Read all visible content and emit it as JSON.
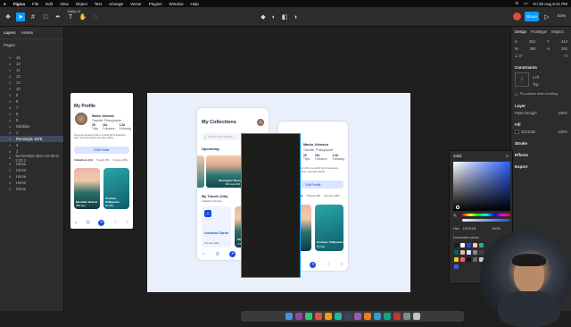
{
  "menubar": {
    "app": "Figma",
    "items": [
      "File",
      "Edit",
      "View",
      "Object",
      "Text",
      "Arrange",
      "Vector",
      "Plugins",
      "Window",
      "Help"
    ],
    "clock": "Fri 29 Aug  8:41 PM"
  },
  "toolbar": {
    "file_tab": "Daily UI",
    "share_label": "Share",
    "zoom": "64%"
  },
  "leftpanel": {
    "tabs": [
      "Layers",
      "Assets"
    ],
    "pages_label": "Pages",
    "layers": [
      {
        "label": "15",
        "selected": false
      },
      {
        "label": "14",
        "selected": false
      },
      {
        "label": "11",
        "selected": false
      },
      {
        "label": "13",
        "selected": false
      },
      {
        "label": "12",
        "selected": false
      },
      {
        "label": "10",
        "selected": false
      },
      {
        "label": "9",
        "selected": false
      },
      {
        "label": "8",
        "selected": false
      },
      {
        "label": "7",
        "selected": false
      },
      {
        "label": "6",
        "selected": false
      },
      {
        "label": "5",
        "selected": false
      },
      {
        "label": "Dribbble",
        "selected": false
      },
      {
        "label": "1",
        "selected": false
      },
      {
        "label": "Rectangle 1878",
        "selected": true
      },
      {
        "label": "3",
        "selected": false
      },
      {
        "label": "2",
        "selected": false
      },
      {
        "label": "Screenshot 2021-10-09 at 2.32.1",
        "selected": false
      },
      {
        "label": "Home",
        "selected": false
      },
      {
        "label": "Home",
        "selected": false
      },
      {
        "label": "Home",
        "selected": false
      },
      {
        "label": "Home",
        "selected": false
      },
      {
        "label": "Home",
        "selected": false
      }
    ]
  },
  "rightpanel": {
    "tabs": [
      "Design",
      "Prototype",
      "Inspect"
    ],
    "x": "350",
    "y": "244",
    "w": "393",
    "h": "393",
    "constraints_label": "Constraints",
    "constraint_h": "Left",
    "constraint_v": "Top",
    "fix_label": "Fix position when scrolling",
    "layer_label": "Layer",
    "pass_through": "Pass through",
    "layer_opacity": "100%",
    "fill_label": "Fill",
    "fill_hex": "1D1D1B",
    "fill_opacity": "100%",
    "stroke_label": "Stroke",
    "effects_label": "Effects",
    "export_label": "Export"
  },
  "picker": {
    "mode": "Solid",
    "hex_label": "Hex",
    "hex": "1D1D1B",
    "alpha": "100%",
    "doc_colors_label": "Document colors",
    "swatches": [
      "#1d1d1b",
      "#ffffff",
      "#1d4ed8",
      "#f4c9a9",
      "#2aa6a8",
      "#0c5e6b",
      "#e7b8a8",
      "#d9e4ff",
      "#888888",
      "#444444",
      "#ffcc00",
      "#ff5a5a",
      "#111111",
      "#666666",
      "#cccccc",
      "#3b5bdb"
    ]
  },
  "profile_small": {
    "title": "My Profile",
    "name": "Marko Johnson",
    "subtitle": "Traveller, Photographer",
    "stats": [
      {
        "v": "25",
        "l": "Trips"
      },
      {
        "v": "11k",
        "l": "Followers"
      },
      {
        "v": "1.2k",
        "l": "Following"
      }
    ],
    "bio": "Living the dreamer's life in a world full of dreamers. Here, the short travel. Germany, Berlin",
    "edit": "Edit Profile",
    "tabs": [
      "Collections (14)",
      "Travels (56)",
      "Groups (48k)"
    ],
    "cards": [
      {
        "title": "Mustafan Bakroh",
        "date": "28th May"
      },
      {
        "title": "Pordoan, Philippines",
        "date": "5th May"
      }
    ]
  },
  "collections": {
    "title": "My Collections",
    "search_placeholder": "Search your places...",
    "upcoming": "Upcoming",
    "see_all": "See All",
    "upcoming_card": {
      "title": "Mustaghan Mountains",
      "date": "29th Aug 2021"
    },
    "travels_label": "My Travels (23k)",
    "travels_sub": "Collection (32 trips)",
    "add": "+ Add",
    "card1": {
      "title": "Uncurled Cards",
      "date": "3rd June 2021"
    },
    "card2": {
      "title": "Mustafan Bakroh",
      "date": "2nd Aug 2021"
    }
  },
  "profile_big": {
    "name": "Marko Johnson",
    "subtitle": "Traveller, Photographer",
    "stats": [
      {
        "v": "25",
        "l": "Trips"
      },
      {
        "v": "11k",
        "l": "Followers"
      },
      {
        "v": "1.2k",
        "l": "Following"
      }
    ],
    "bio": "Living the dreamer's life in a world full of dreamers. Here, the short travel. Germany, Berlin",
    "edit": "Edit Profile",
    "tabs": [
      "Collections (14)",
      "Travels (56)",
      "Groups (48k)"
    ],
    "cards": [
      {
        "title": "Pordoan, Philippines",
        "date": "5th May"
      }
    ]
  }
}
